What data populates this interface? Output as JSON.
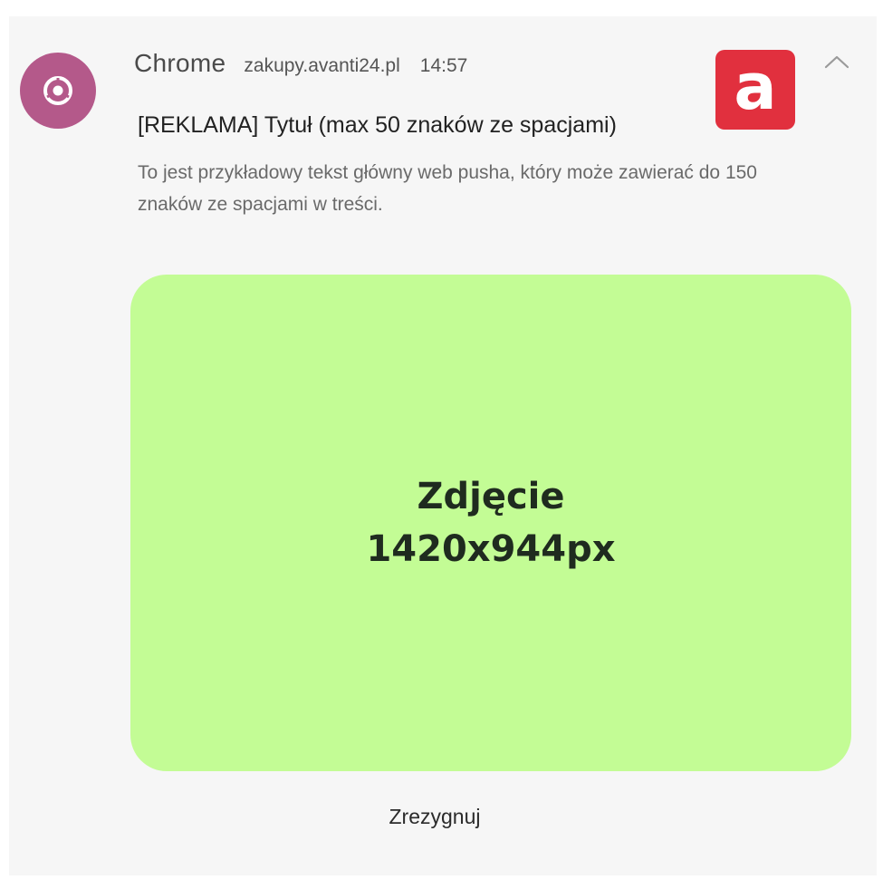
{
  "notification": {
    "app_name": "Chrome",
    "app_icon": "chrome-icon",
    "domain": "zakupy.avanti24.pl",
    "time": "14:57",
    "title": "[REKLAMA] Tytuł (max 50 znaków ze spacjami)",
    "body": "To jest przykładowy tekst główny web pusha, który może zawierać do 150 znaków ze spacjami w treści.",
    "brand_logo_letter": "a",
    "collapse_icon": "chevron-up-icon",
    "image": {
      "line1": "Zdjęcie",
      "line2": "1420x944px"
    },
    "action_label": "Zrezygnuj"
  },
  "colors": {
    "app_icon_bg": "#b4598a",
    "brand_logo_bg": "#e1303e",
    "image_bg": "#c3fc95",
    "card_bg": "#f6f6f6"
  }
}
